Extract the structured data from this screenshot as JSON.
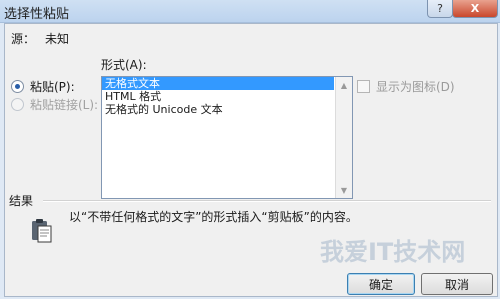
{
  "window": {
    "title": "选择性粘贴",
    "help_glyph": "?",
    "close_glyph": "X"
  },
  "source": {
    "label": "源：",
    "value": "未知"
  },
  "format": {
    "label": "形式(A):"
  },
  "options": {
    "paste_label": "粘贴(P):",
    "paste_link_label": "粘贴链接(L):",
    "paste_selected": true
  },
  "formats_list": {
    "items": [
      "无格式文本",
      "HTML 格式",
      "无格式的 Unicode 文本"
    ],
    "selected_index": 0
  },
  "display_as_icon": {
    "label": "显示为图标(D)",
    "checked": false
  },
  "result": {
    "label": "结果",
    "text": "以“不带任何格式的文字”的形式插入“剪贴板”的内容。"
  },
  "buttons": {
    "ok": "确定",
    "cancel": "取消"
  },
  "watermark": "我爱IT技术网"
}
